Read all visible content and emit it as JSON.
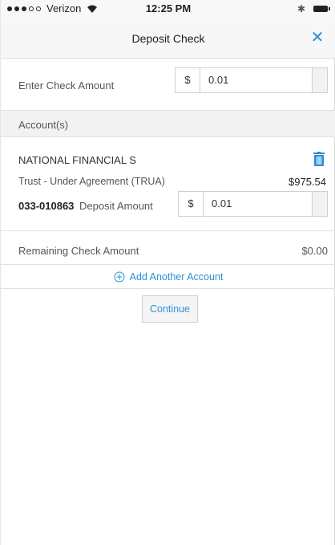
{
  "status_bar": {
    "carrier": "Verizon",
    "time": "12:25 PM",
    "bluetooth": "✱"
  },
  "header": {
    "title": "Deposit Check",
    "close_icon": "close-icon"
  },
  "check_amount": {
    "label": "Enter Check Amount",
    "currency": "$",
    "value": "0.01"
  },
  "accounts_section": {
    "title": "Account(s)"
  },
  "account": {
    "name": "NATIONAL FINANCIAL S",
    "type": "Trust - Under Agreement (TRUA)",
    "balance": "$975.54",
    "number": "033-010863",
    "deposit_label": "Deposit Amount",
    "currency": "$",
    "deposit_value": "0.01"
  },
  "remaining": {
    "label": "Remaining Check Amount",
    "value": "$0.00"
  },
  "add_account": {
    "label": "Add Another Account"
  },
  "continue": {
    "label": "Continue"
  },
  "colors": {
    "accent": "#2d8fd5",
    "section_bg": "#f2f2f2"
  }
}
